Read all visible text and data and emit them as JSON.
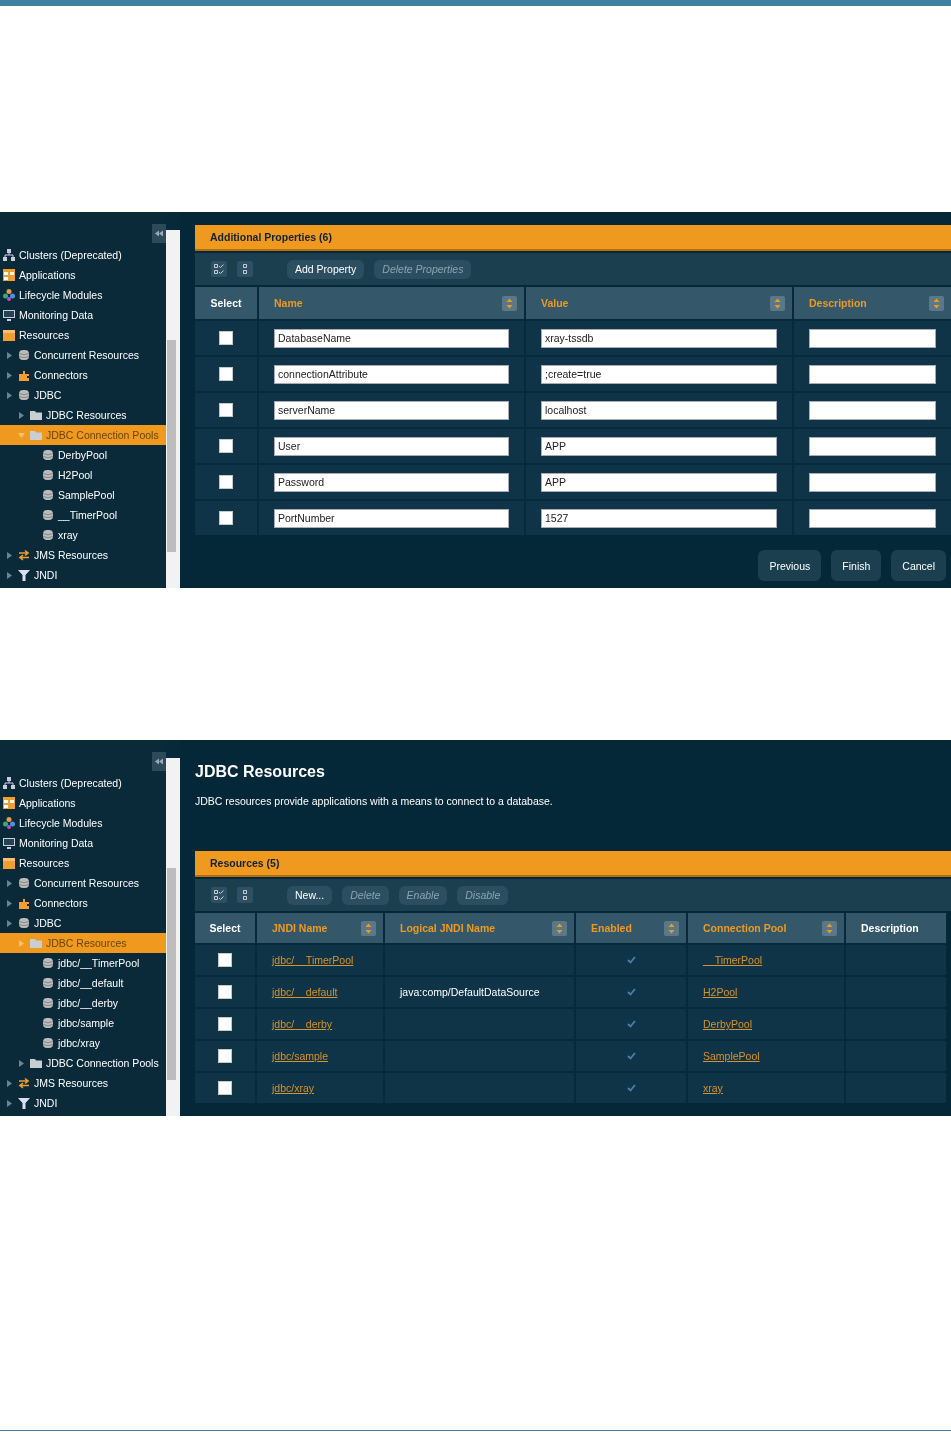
{
  "screens": [
    {
      "kind": "properties",
      "sidebar": {
        "items": [
          {
            "label": "Clusters (Deprecated)",
            "kind": "cluster",
            "selected": false
          },
          {
            "label": "Applications",
            "kind": "applications",
            "selected": false
          },
          {
            "label": "Lifecycle Modules",
            "kind": "modules",
            "selected": false
          },
          {
            "label": "Monitoring Data",
            "kind": "monitor",
            "selected": false
          },
          {
            "label": "Resources",
            "kind": "resources",
            "selected": false,
            "children": [
              {
                "label": "Concurrent Resources",
                "kind": "database",
                "selected": false,
                "expanded": false
              },
              {
                "label": "Connectors",
                "kind": "connector",
                "selected": false,
                "expanded": false
              },
              {
                "label": "JDBC",
                "kind": "database",
                "selected": false,
                "expanded": false,
                "children": [
                  {
                    "label": "JDBC Resources",
                    "kind": "folder",
                    "selected": false,
                    "expanded": false
                  },
                  {
                    "label": "JDBC Connection Pools",
                    "kind": "folder",
                    "selected": true,
                    "expanded": true,
                    "children": [
                      {
                        "label": "DerbyPool",
                        "kind": "database",
                        "selected": false
                      },
                      {
                        "label": "H2Pool",
                        "kind": "database",
                        "selected": false
                      },
                      {
                        "label": "SamplePool",
                        "kind": "database",
                        "selected": false
                      },
                      {
                        "label": "__TimerPool",
                        "kind": "database",
                        "selected": false
                      },
                      {
                        "label": "xray",
                        "kind": "database",
                        "selected": false
                      }
                    ]
                  }
                ]
              },
              {
                "label": "JMS Resources",
                "kind": "exchange",
                "selected": false,
                "expanded": false
              },
              {
                "label": "JNDI",
                "kind": "filter",
                "selected": false,
                "expanded": false
              }
            ]
          }
        ]
      },
      "panel": {
        "heading": "Additional Properties (6)",
        "toolbar": [
          {
            "label": "Add Property",
            "disabled": false
          },
          {
            "label": "Delete Properties",
            "disabled": true
          }
        ],
        "columns": [
          {
            "label": "Select",
            "sortable": false
          },
          {
            "label": "Name",
            "sortable": true
          },
          {
            "label": "Value",
            "sortable": true
          },
          {
            "label": "Description",
            "sortable": true
          }
        ],
        "rows": [
          {
            "selected": false,
            "name": "DatabaseName",
            "value": "xray-tssdb"
          },
          {
            "selected": false,
            "name": "connectionAttribute",
            "value": ";create=true"
          },
          {
            "selected": false,
            "name": "serverName",
            "value": "localhost"
          },
          {
            "selected": false,
            "name": "User",
            "value": "APP"
          },
          {
            "selected": false,
            "name": "Password",
            "value": "APP"
          },
          {
            "selected": false,
            "name": "PortNumber",
            "value": "1527"
          }
        ],
        "footer_buttons": [
          "Previous",
          "Finish",
          "Cancel"
        ]
      }
    },
    {
      "kind": "resources",
      "sidebar": {
        "items": [
          {
            "label": "Clusters (Deprecated)",
            "kind": "cluster",
            "selected": false
          },
          {
            "label": "Applications",
            "kind": "applications",
            "selected": false
          },
          {
            "label": "Lifecycle Modules",
            "kind": "modules",
            "selected": false
          },
          {
            "label": "Monitoring Data",
            "kind": "monitor",
            "selected": false
          },
          {
            "label": "Resources",
            "kind": "resources",
            "selected": false,
            "children": [
              {
                "label": "Concurrent Resources",
                "kind": "database",
                "selected": false,
                "expanded": false
              },
              {
                "label": "Connectors",
                "kind": "connector",
                "selected": false,
                "expanded": false
              },
              {
                "label": "JDBC",
                "kind": "database",
                "selected": false,
                "expanded": false,
                "children": [
                  {
                    "label": "JDBC Resources",
                    "kind": "folder",
                    "selected": true,
                    "expanded": false,
                    "children": [
                      {
                        "label": "jdbc/__TimerPool",
                        "kind": "database",
                        "selected": false
                      },
                      {
                        "label": "jdbc/__default",
                        "kind": "database",
                        "selected": false
                      },
                      {
                        "label": "jdbc/__derby",
                        "kind": "database",
                        "selected": false
                      },
                      {
                        "label": "jdbc/sample",
                        "kind": "database",
                        "selected": false
                      },
                      {
                        "label": "jdbc/xray",
                        "kind": "database",
                        "selected": false
                      }
                    ]
                  },
                  {
                    "label": "JDBC Connection Pools",
                    "kind": "folder",
                    "selected": false,
                    "expanded": false
                  }
                ]
              },
              {
                "label": "JMS Resources",
                "kind": "exchange",
                "selected": false,
                "expanded": false
              },
              {
                "label": "JNDI",
                "kind": "filter",
                "selected": false,
                "expanded": false
              }
            ]
          }
        ]
      },
      "panel": {
        "title": "JDBC Resources",
        "description": "JDBC resources provide applications with a means to connect to a database.",
        "heading": "Resources (5)",
        "toolbar": [
          {
            "label": "New...",
            "disabled": false
          },
          {
            "label": "Delete",
            "disabled": true
          },
          {
            "label": "Enable",
            "disabled": true
          },
          {
            "label": "Disable",
            "disabled": true
          }
        ],
        "columns": [
          {
            "label": "Select",
            "sortable": false
          },
          {
            "label": "JNDI Name",
            "sortable": true
          },
          {
            "label": "Logical JNDI Name",
            "sortable": true
          },
          {
            "label": "Enabled",
            "sortable": true
          },
          {
            "label": "Connection Pool",
            "sortable": true
          },
          {
            "label": "Description",
            "sortable": false
          }
        ],
        "rows": [
          {
            "selected": false,
            "jndi_name": "jdbc/__TimerPool",
            "enabled": true,
            "connection_pool": "__TimerPool"
          },
          {
            "selected": false,
            "jndi_name": "jdbc/__default",
            "logical_jndi_name": "java:comp/DefaultDataSource",
            "enabled": true,
            "connection_pool": "H2Pool"
          },
          {
            "selected": false,
            "jndi_name": "jdbc/__derby",
            "enabled": true,
            "connection_pool": "DerbyPool"
          },
          {
            "selected": false,
            "jndi_name": "jdbc/sample",
            "enabled": true,
            "connection_pool": "SamplePool"
          },
          {
            "selected": false,
            "jndi_name": "jdbc/xray",
            "enabled": true,
            "connection_pool": "xray"
          }
        ]
      }
    }
  ]
}
